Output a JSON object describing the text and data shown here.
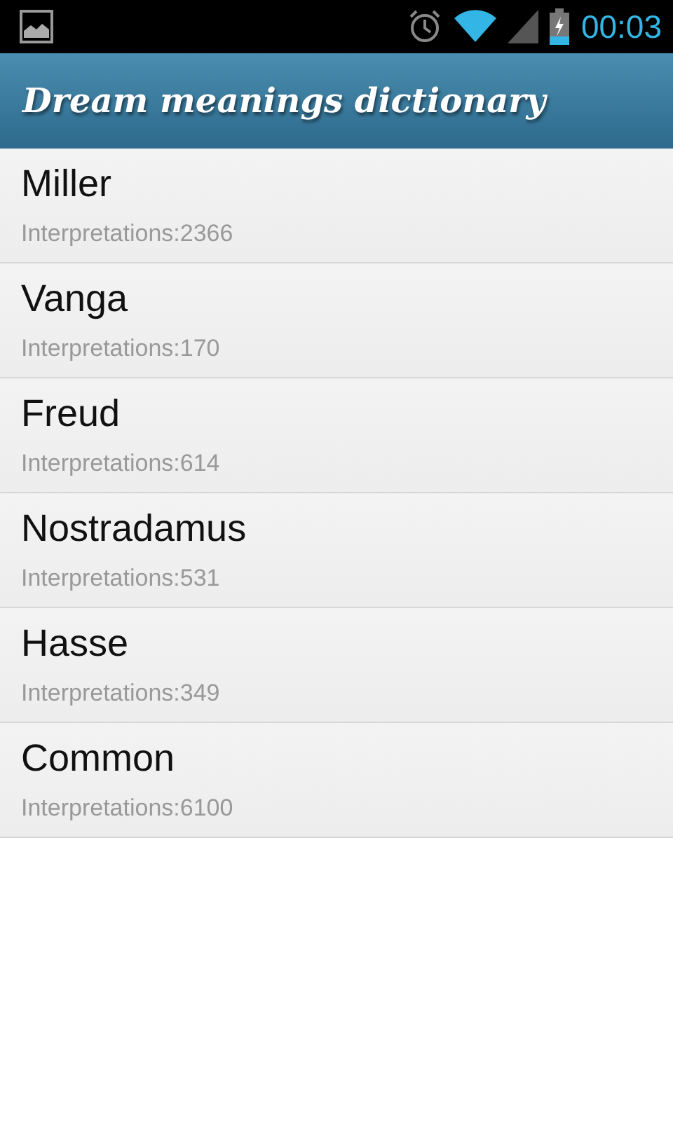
{
  "status_bar": {
    "time": "00:03"
  },
  "app_bar": {
    "title": "Dream meanings dictionary"
  },
  "dictionaries": [
    {
      "name": "Miller",
      "subtitle": "Interpretations:2366"
    },
    {
      "name": "Vanga",
      "subtitle": "Interpretations:170"
    },
    {
      "name": "Freud",
      "subtitle": "Interpretations:614"
    },
    {
      "name": "Nostradamus",
      "subtitle": "Interpretations:531"
    },
    {
      "name": "Hasse",
      "subtitle": "Interpretations:349"
    },
    {
      "name": "Common",
      "subtitle": "Interpretations:6100"
    }
  ]
}
